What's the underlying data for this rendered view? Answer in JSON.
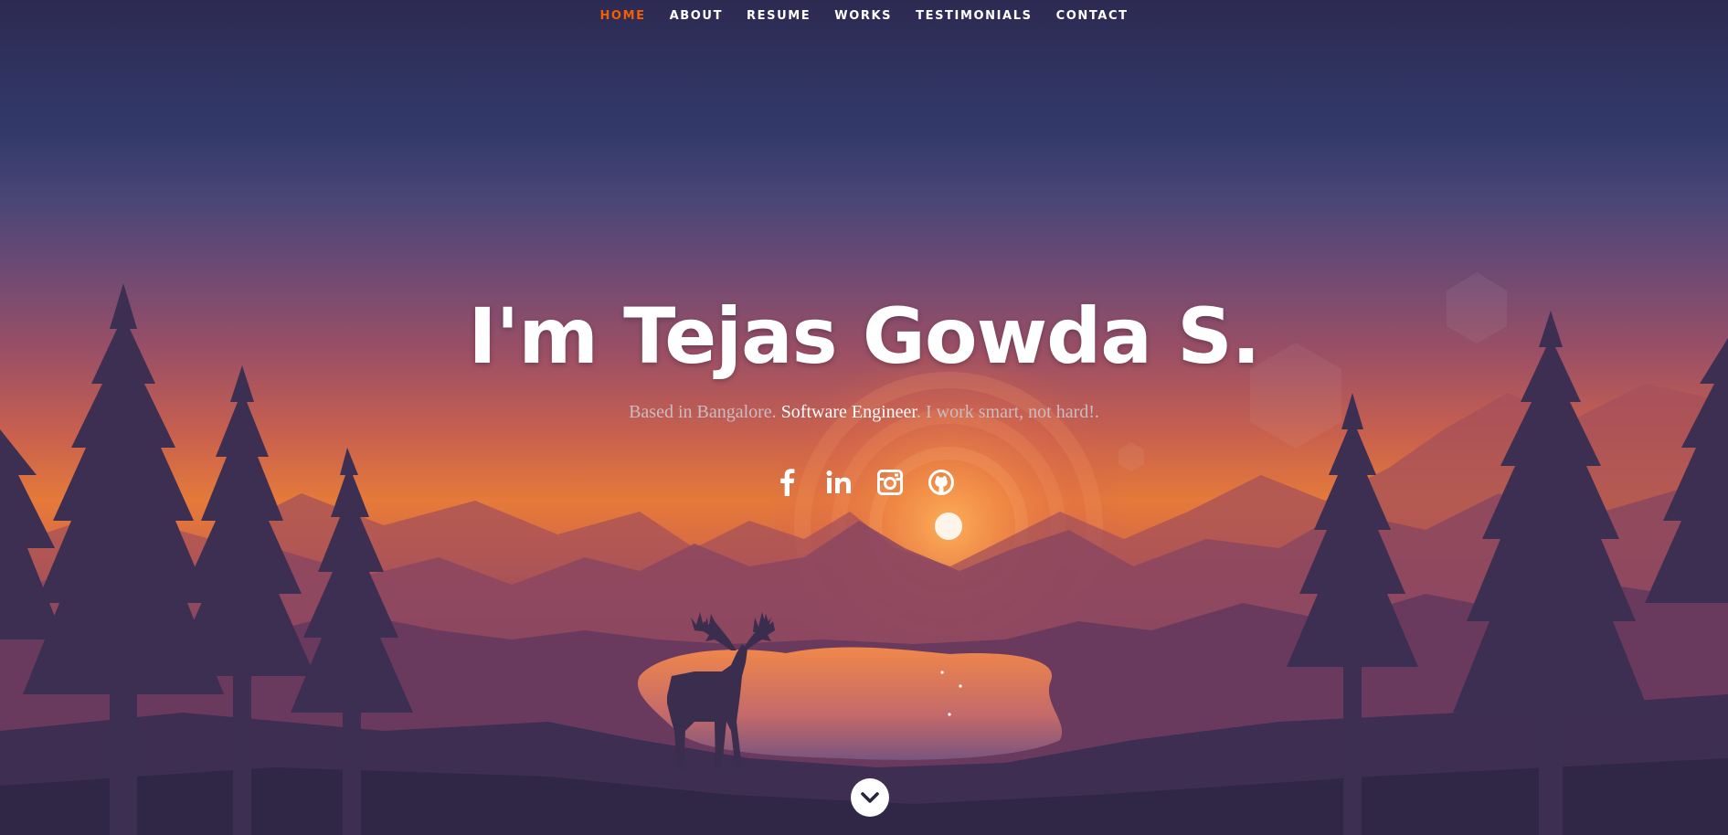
{
  "nav": {
    "items": [
      {
        "label": "HOME",
        "active": true
      },
      {
        "label": "ABOUT",
        "active": false
      },
      {
        "label": "RESUME",
        "active": false
      },
      {
        "label": "WORKS",
        "active": false
      },
      {
        "label": "TESTIMONIALS",
        "active": false
      },
      {
        "label": "CONTACT",
        "active": false
      }
    ],
    "active_color": "#f06000"
  },
  "hero": {
    "title": "I'm Tejas Gowda S.",
    "subtitle_pre": "Based in Bangalore. ",
    "subtitle_highlight": "Software Engineer",
    "subtitle_post": ". I work smart, not hard!."
  },
  "social": [
    {
      "name": "facebook-icon"
    },
    {
      "name": "linkedin-icon"
    },
    {
      "name": "instagram-icon"
    },
    {
      "name": "github-icon"
    }
  ],
  "scroll_down": {
    "icon": "chevron-down-icon"
  }
}
